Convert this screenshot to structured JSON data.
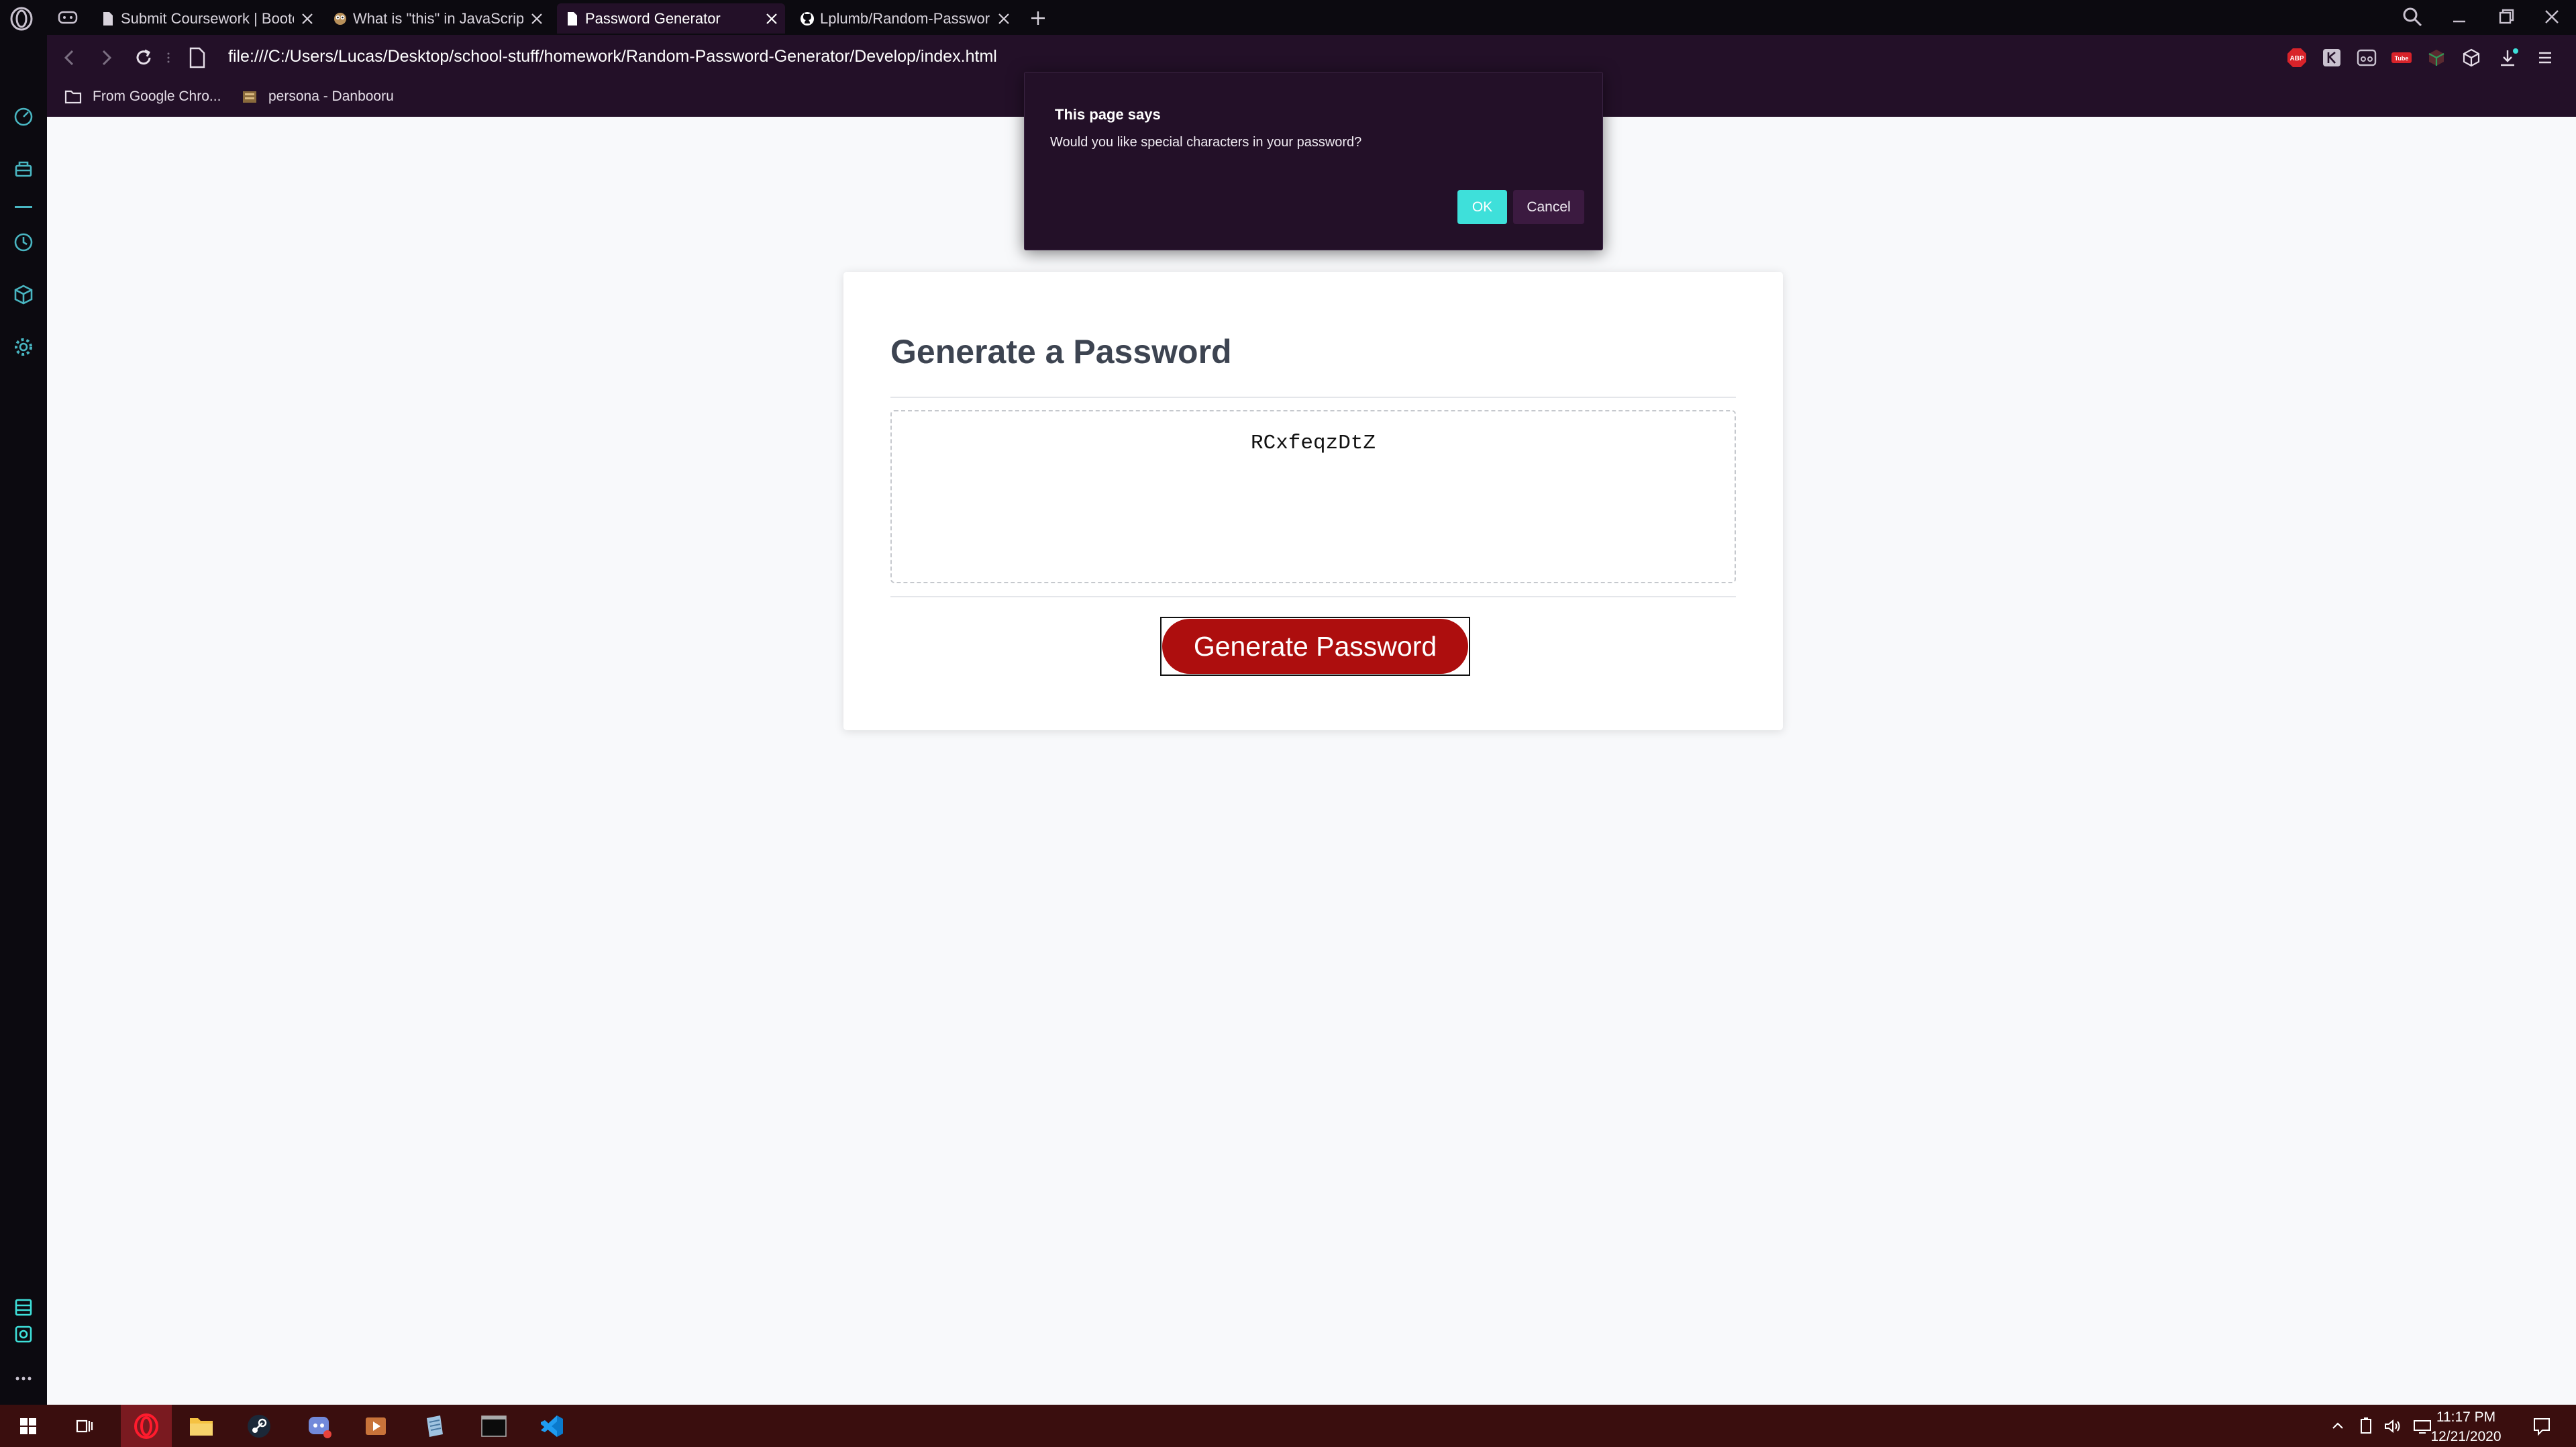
{
  "browser": {
    "tabs": [
      {
        "title": "Submit Coursework | Bootc",
        "active": false
      },
      {
        "title": "What is \"this\" in JavaScript",
        "active": false
      },
      {
        "title": "Password Generator",
        "active": true
      },
      {
        "title": "Lplumb/Random-Password",
        "active": false
      }
    ],
    "url": "file:///C:/Users/Lucas/Desktop/school-stuff/homework/Random-Password-Generator/Develop/index.html",
    "bookmarks": [
      {
        "label": "From Google Chro...",
        "icon": "folder-icon"
      },
      {
        "label": "persona - Danbooru",
        "icon": "danbooru-favicon"
      }
    ],
    "extensions": {
      "adblock_badge": "ABP",
      "yt_badge": "Tube"
    },
    "accent": "#231028"
  },
  "page": {
    "heading": "Generate a Password",
    "password": "RCxfeqzDtZ",
    "generate_label": "Generate Password",
    "button_color": "#ad0e0e"
  },
  "dialog": {
    "title": "This page says",
    "message": "Would you like special characters in your password?",
    "ok_label": "OK",
    "cancel_label": "Cancel",
    "ok_color": "#3ee0da"
  },
  "taskbar": {
    "time": "11:17 PM",
    "date": "12/21/2020"
  }
}
